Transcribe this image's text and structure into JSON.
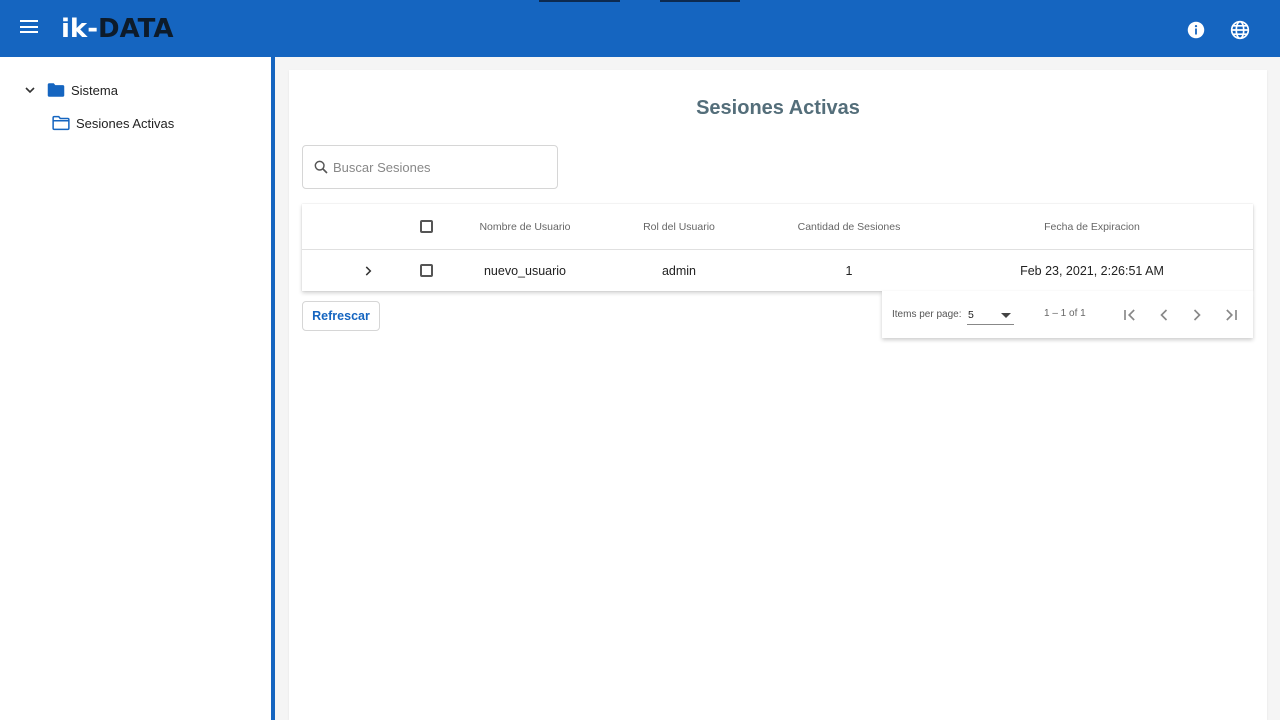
{
  "header": {
    "logo": {
      "part1": "ik-",
      "part2": "DATA"
    },
    "menu_icon": "menu-icon",
    "info_icon": "info-icon",
    "language_icon": "globe-icon",
    "colors": {
      "primary": "#1565c0"
    }
  },
  "sidebar": {
    "tree": [
      {
        "label": "Sistema",
        "icon": "folder-filled-icon",
        "expanded": true
      },
      {
        "label": "Sesiones Activas",
        "icon": "folder-outline-icon"
      }
    ]
  },
  "main": {
    "title": "Sesiones Activas",
    "search": {
      "placeholder": "Buscar Sesiones",
      "value": ""
    },
    "table": {
      "columns": [
        "Nombre de Usuario",
        "Rol del Usuario",
        "Cantidad de Sesiones",
        "Fecha de Expiracion"
      ],
      "rows": [
        {
          "user": "nuevo_usuario",
          "role": "admin",
          "sessions": "1",
          "expiration": "Feb 23, 2021, 2:26:51 AM"
        }
      ]
    },
    "refresh_label": "Refrescar",
    "paginator": {
      "items_per_page_label": "Items per page:",
      "page_size": "5",
      "range": "1 – 1 of 1"
    }
  }
}
